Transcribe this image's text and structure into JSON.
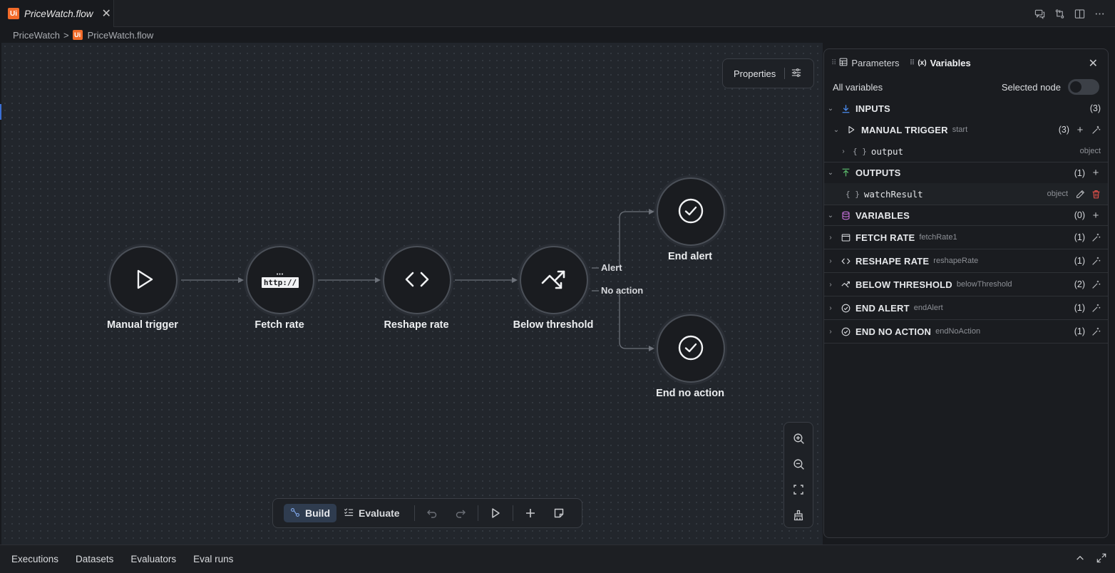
{
  "editor_tab": {
    "logo": "Ui",
    "title": "PriceWatch.flow",
    "close": "✕"
  },
  "breadcrumb": {
    "project": "PriceWatch",
    "sep": ">",
    "logo": "Ui",
    "file": "PriceWatch.flow"
  },
  "canvas": {
    "properties_label": "Properties",
    "nodes": {
      "manual_trigger": "Manual trigger",
      "fetch_rate": "Fetch rate",
      "fetch_rate_badge": "http://",
      "reshape_rate": "Reshape rate",
      "below_threshold": "Below threshold",
      "end_alert": "End alert",
      "end_no_action": "End no action"
    },
    "edges": {
      "alert": "Alert",
      "no_action": "No action"
    }
  },
  "toolbar": {
    "build": "Build",
    "evaluate": "Evaluate"
  },
  "panel": {
    "tabs": {
      "parameters": "Parameters",
      "variables": "Variables"
    },
    "close": "✕",
    "all_variables": "All variables",
    "selected_node": "Selected node",
    "inputs": {
      "name": "INPUTS",
      "count": "(3)"
    },
    "manual_trigger": {
      "name": "MANUAL TRIGGER",
      "sub": "start",
      "count": "(3)"
    },
    "output": {
      "name": "output",
      "type": "object",
      "brace": "{ }"
    },
    "outputs": {
      "name": "OUTPUTS",
      "count": "(1)"
    },
    "watch_result": {
      "name": "watchResult",
      "type": "object",
      "brace": "{ }"
    },
    "variables": {
      "name": "VARIABLES",
      "count": "(0)"
    },
    "fetch_rate": {
      "name": "FETCH RATE",
      "sub": "fetchRate1",
      "count": "(1)"
    },
    "reshape_rate": {
      "name": "RESHAPE RATE",
      "sub": "reshapeRate",
      "count": "(1)"
    },
    "below_threshold": {
      "name": "BELOW THRESHOLD",
      "sub": "belowThreshold",
      "count": "(2)"
    },
    "end_alert": {
      "name": "END ALERT",
      "sub": "endAlert",
      "count": "(1)"
    },
    "end_no_action": {
      "name": "END NO ACTION",
      "sub": "endNoAction",
      "count": "(1)"
    }
  },
  "bottom_tabs": {
    "executions": "Executions",
    "datasets": "Datasets",
    "evaluators": "Evaluators",
    "eval_runs": "Eval runs"
  },
  "colors": {
    "accent": "#3b6fd4",
    "brand": "#f26b2a",
    "inputs_icon": "#4a8cf0",
    "outputs_icon": "#58b368",
    "variables_icon": "#c470d8",
    "delete": "#e0504a"
  }
}
